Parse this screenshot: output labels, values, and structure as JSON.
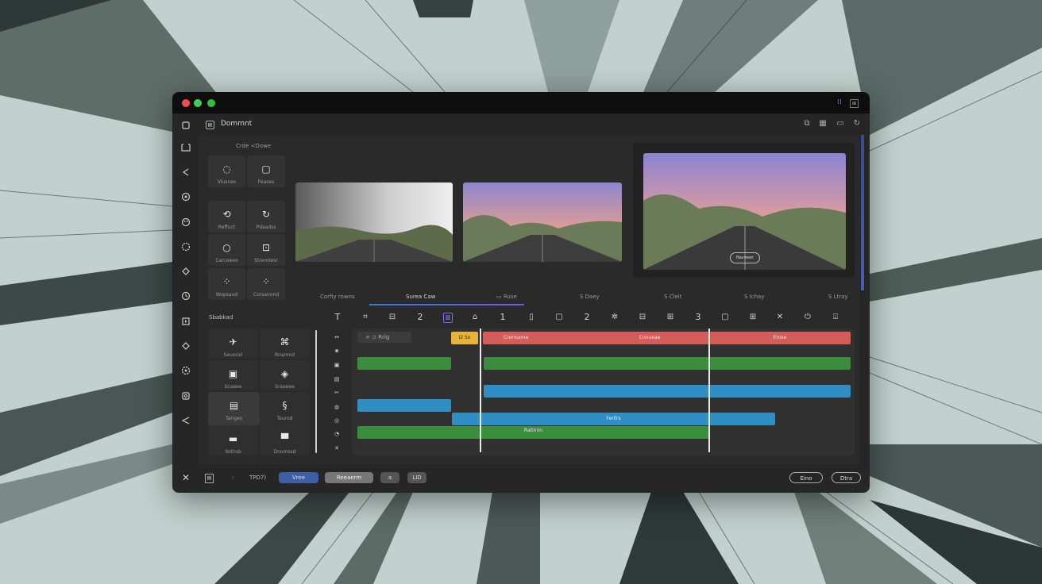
{
  "colors": {
    "accent_blue": "#3d5fa8",
    "clip_red": "#d45c5a",
    "clip_green": "#3a8d3a",
    "clip_blue": "#2f8ec4",
    "clip_yellow": "#e8b33a",
    "tab_underline": "#5a54d8",
    "selected_tool": "#7a6cf0"
  },
  "window": {
    "title": "Dommnt",
    "title_icon": "document-icon",
    "header_actions": [
      "layout-icon",
      "grid-icon",
      "menu-icon",
      "refresh-icon"
    ]
  },
  "rail_icons": [
    "square-icon",
    "folder-icon",
    "back-icon",
    "play-circle-icon",
    "record-icon",
    "cog-icon",
    "diamond-icon",
    "clock-icon",
    "export-icon",
    "diamond-outline-icon",
    "settings-icon",
    "image-icon",
    "send-icon"
  ],
  "library": {
    "header": "Crde <Dowe",
    "tiles": [
      {
        "icon": "dotted-circle-icon",
        "label": "Vlusnes"
      },
      {
        "icon": "rounded-square-icon",
        "label": "Feases"
      },
      {
        "icon": "loop-icon",
        "label": "Reffuct"
      },
      {
        "icon": "refresh-circle-icon",
        "label": "Pdaadss"
      },
      {
        "icon": "circle-icon",
        "label": "Carceeeo"
      },
      {
        "icon": "square-dot-icon",
        "label": "Stremtesr"
      },
      {
        "icon": "grid-dots-icon",
        "label": "Wopsaud"
      },
      {
        "icon": "grid-dots-icon",
        "label": "Corsanond"
      }
    ]
  },
  "previews": {
    "tabs": [
      "Corfiy rowns",
      "Surea Caw",
      "Ruse",
      "S Daey",
      "S Cleit",
      "S Ichay",
      "S Ltray"
    ],
    "player_button": "Navweer"
  },
  "effects": {
    "header": "Sbabkad",
    "tiles": [
      {
        "icon": "move-icon",
        "label": "Seuocel"
      },
      {
        "icon": "frame-icon",
        "label": "Rnamnd"
      },
      {
        "icon": "monitor-icon",
        "label": "Scaaee"
      },
      {
        "icon": "diamond-small-icon",
        "label": "Sraaeee"
      },
      {
        "icon": "caption-icon",
        "label": "Tariges"
      },
      {
        "icon": "mask-icon",
        "label": "Tourod"
      },
      {
        "icon": "film-icon",
        "label": "Sotnsb"
      },
      {
        "icon": "display-icon",
        "label": "Dnomssd"
      }
    ]
  },
  "timeline": {
    "toolbar": [
      {
        "icon": "text-icon",
        "glyph": "T"
      },
      {
        "icon": "crop-icon"
      },
      {
        "icon": "split-icon"
      },
      {
        "icon": "number-icon",
        "glyph": "2"
      },
      {
        "icon": "cut-icon",
        "selected": true
      },
      {
        "icon": "link-icon"
      },
      {
        "icon": "number-icon",
        "glyph": "1"
      },
      {
        "icon": "marker-icon"
      },
      {
        "icon": "select-icon"
      },
      {
        "icon": "number-icon",
        "glyph": "2"
      },
      {
        "icon": "effects-icon"
      },
      {
        "icon": "transition-icon"
      },
      {
        "icon": "grid-icon"
      },
      {
        "icon": "number-icon",
        "glyph": "3"
      },
      {
        "icon": "square-icon"
      },
      {
        "icon": "table-icon"
      },
      {
        "icon": "close-icon",
        "glyph": "✕"
      },
      {
        "icon": "download-icon"
      },
      {
        "icon": "upload-icon"
      }
    ],
    "track_icons": [
      "arrows-icon",
      "sun-icon",
      "audio-icon",
      "mic-icon",
      "scissors-icon",
      "lock-icon",
      "eye-icon",
      "mute-icon",
      "cross-icon"
    ],
    "add_button": "Rrlg",
    "clips": {
      "yellow_label": "I2   So",
      "red_label_1": "Cremuona",
      "red_label_2": "Cnnueae",
      "red_label_3": "Erose",
      "blue_label": "Ferllrs",
      "green_label": "Ratinnn"
    }
  },
  "footer": {
    "left_icons": [
      "brand-icon",
      "file-icon"
    ],
    "counter": "TPD7)",
    "counter_prefix": ":",
    "btn_primary": "Vree",
    "btn_secondary": "Reeaerm",
    "btn_small_1": "a",
    "btn_small_2": "LID",
    "btn_right_1": "Eino",
    "btn_right_2": "Dtra"
  }
}
